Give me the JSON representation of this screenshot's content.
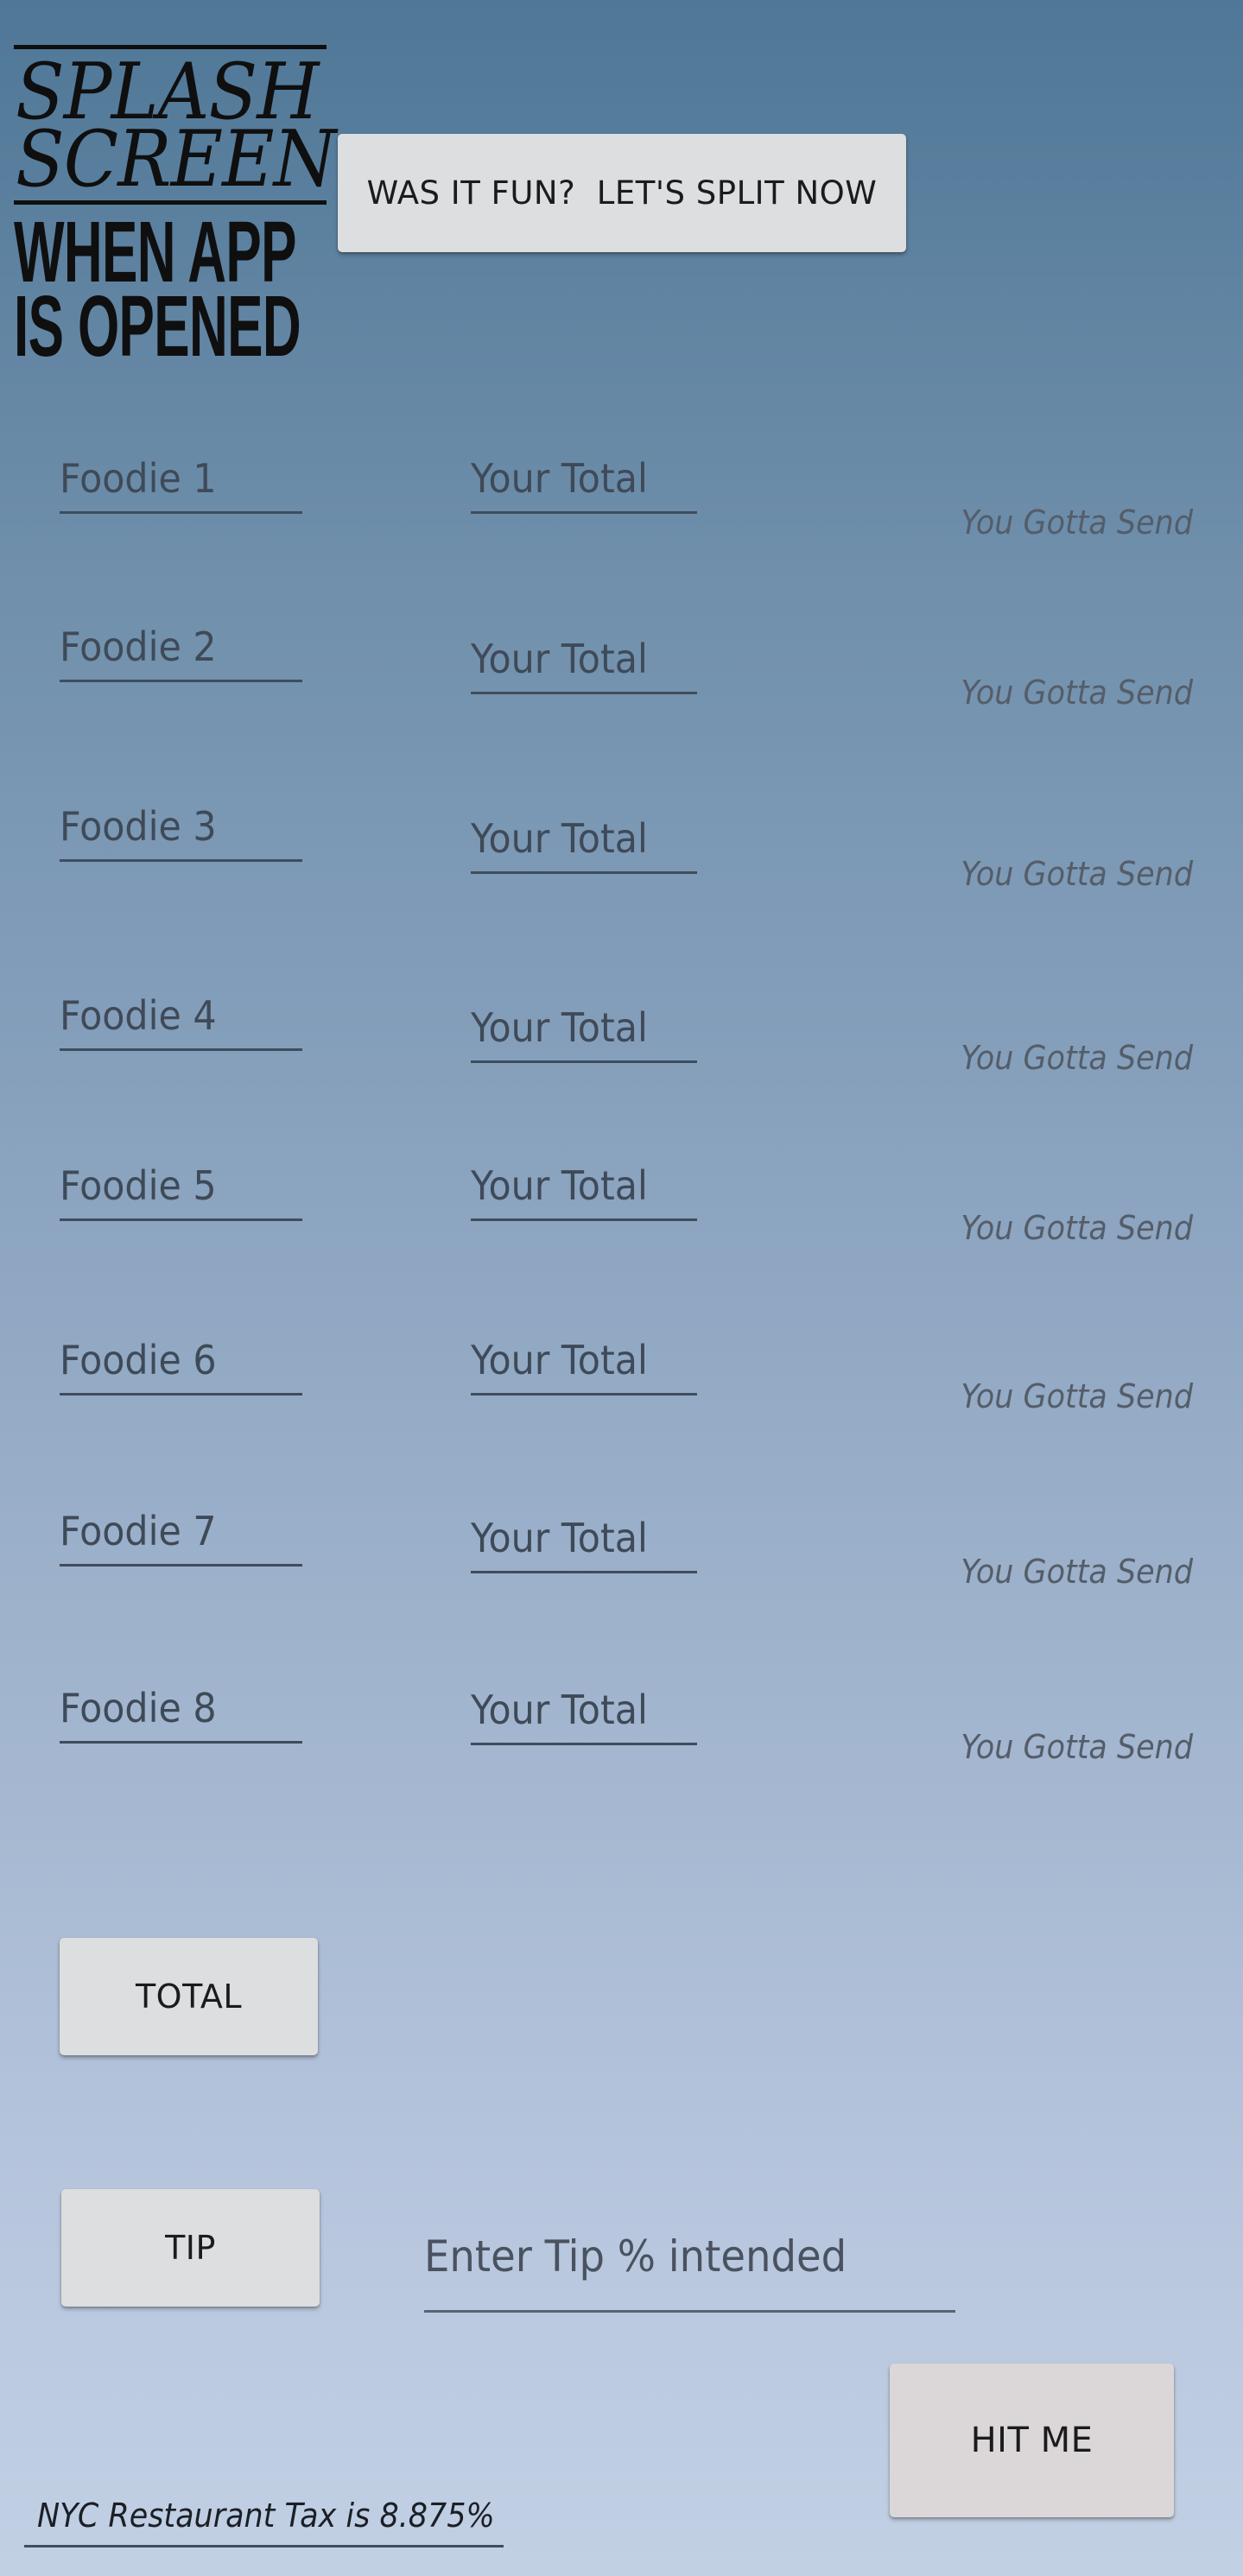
{
  "splash_logo": {
    "line1": "SPLASH",
    "line2": "SCREEN",
    "line3": "WHEN APP",
    "line4": "IS OPENED"
  },
  "split_button_label": "WAS IT FUN?  LET'S SPLIT NOW",
  "foodies": [
    {
      "name_placeholder": "Foodie 1",
      "total_placeholder": "Your Total",
      "send_label": "You Gotta Send"
    },
    {
      "name_placeholder": "Foodie 2",
      "total_placeholder": "Your Total",
      "send_label": "You Gotta Send"
    },
    {
      "name_placeholder": "Foodie 3",
      "total_placeholder": "Your Total",
      "send_label": "You Gotta Send"
    },
    {
      "name_placeholder": "Foodie 4",
      "total_placeholder": "Your Total",
      "send_label": "You Gotta Send"
    },
    {
      "name_placeholder": "Foodie 5",
      "total_placeholder": "Your Total",
      "send_label": "You Gotta Send"
    },
    {
      "name_placeholder": "Foodie 6",
      "total_placeholder": "Your Total",
      "send_label": "You Gotta Send"
    },
    {
      "name_placeholder": "Foodie 7",
      "total_placeholder": "Your Total",
      "send_label": "You Gotta Send"
    },
    {
      "name_placeholder": "Foodie 8",
      "total_placeholder": "Your Total",
      "send_label": "You Gotta Send"
    }
  ],
  "total_button_label": "TOTAL",
  "tip_button_label": "TIP",
  "tip_input_placeholder": "Enter Tip % intended",
  "hit_me_button_label": "HIT ME",
  "tax_note": "NYC Restaurant Tax is 8.875%",
  "colors": {
    "background_top": "#4f7797",
    "background_bottom": "#c2d0e4",
    "button_face": "#dcdedf",
    "field_underline": "#3f4d5c"
  }
}
